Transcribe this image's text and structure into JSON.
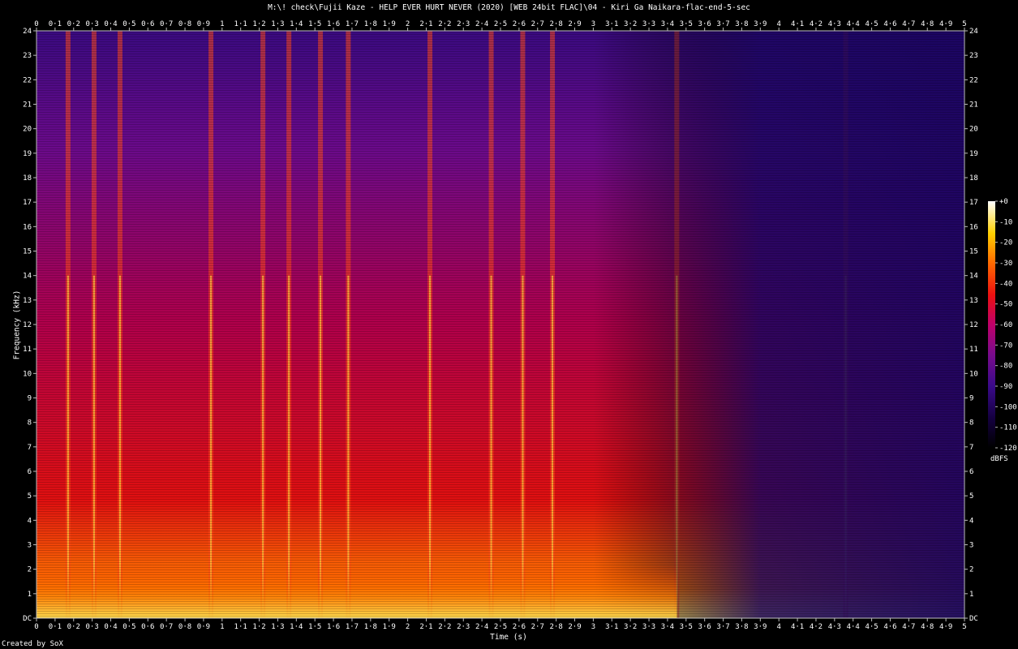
{
  "window": {
    "title": "M:\\! check\\Fujii Kaze - HELP EVER HURT NEVER (2020) [WEB 24bit FLAC]\\04 - Kiri Ga Naikara-flac-end-5-sec",
    "credit": "Created by SoX"
  },
  "chart_data": {
    "type": "heatmap",
    "title": "M:\\! check\\Fujii Kaze - HELP EVER HURT NEVER (2020) [WEB 24bit FLAC]\\04 - Kiri Ga Naikara-flac-end-5-sec",
    "xlabel": "Time (s)",
    "ylabel": "Frequency (kHz)",
    "xlim": [
      0,
      5
    ],
    "ylim": [
      0,
      24
    ],
    "x_ticks": [
      "0",
      "0·1",
      "0·2",
      "0·3",
      "0·4",
      "0·5",
      "0·6",
      "0·7",
      "0·8",
      "0·9",
      "1",
      "1·1",
      "1·2",
      "1·3",
      "1·4",
      "1·5",
      "1·6",
      "1·7",
      "1·8",
      "1·9",
      "2",
      "2·1",
      "2·2",
      "2·3",
      "2·4",
      "2·5",
      "2·6",
      "2·7",
      "2·8",
      "2·9",
      "3",
      "3·1",
      "3·2",
      "3·3",
      "3·4",
      "3·5",
      "3·6",
      "3·7",
      "3·8",
      "3·9",
      "4",
      "4·1",
      "4·2",
      "4·3",
      "4·4",
      "4·5",
      "4·6",
      "4·7",
      "4·8",
      "4·9",
      "5"
    ],
    "y_ticks": [
      "DC",
      "1",
      "2",
      "3",
      "4",
      "5",
      "6",
      "7",
      "8",
      "9",
      "10",
      "11",
      "12",
      "13",
      "14",
      "15",
      "16",
      "17",
      "18",
      "19",
      "20",
      "21",
      "22",
      "23",
      "24"
    ],
    "colorbar": {
      "label": "dBFS",
      "ticks": [
        "+0",
        "-10",
        "-20",
        "-30",
        "-40",
        "-50",
        "-60",
        "-70",
        "-80",
        "-90",
        "-100",
        "-110",
        "-120"
      ],
      "range": [
        -120,
        0
      ]
    },
    "transients_s": [
      0.17,
      0.31,
      0.45,
      0.94,
      1.22,
      1.36,
      1.53,
      1.68,
      2.12,
      2.45,
      2.62,
      2.78,
      3.45,
      4.36
    ]
  }
}
